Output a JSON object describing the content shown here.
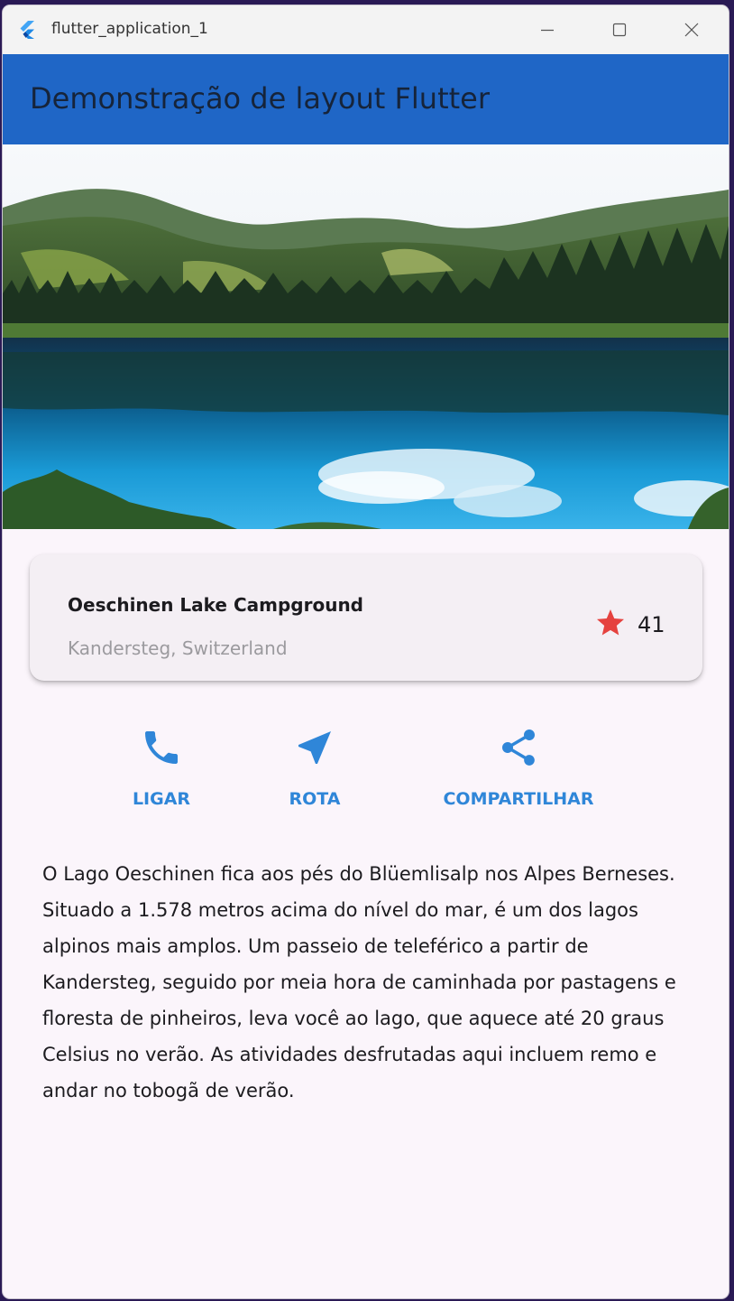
{
  "window": {
    "title": "flutter_application_1"
  },
  "appbar": {
    "title": "Demonstração de layout Flutter",
    "color": "#1f66c6"
  },
  "hero": {
    "alt": "lake-landscape-photo"
  },
  "card": {
    "title": "Oeschinen Lake Campground",
    "subtitle": "Kandersteg, Switzerland",
    "rating": "41",
    "star_color": "#e5423f"
  },
  "actions": [
    {
      "label": "LIGAR",
      "icon": "phone-icon"
    },
    {
      "label": "ROTA",
      "icon": "navigation-arrow-icon"
    },
    {
      "label": "COMPARTILHAR",
      "icon": "share-icon"
    }
  ],
  "accent_color": "#2f86d8",
  "description": "O Lago Oeschinen fica aos pés do Blüemlisalp nos Alpes Berneses. Situado a 1.578 metros acima do nível do mar, é um dos lagos alpinos mais amplos. Um passeio de teleférico a partir de Kandersteg, seguido por meia hora de caminhada por pastagens e floresta de pinheiros, leva você ao lago, que aquece até 20 graus Celsius no verão. As atividades desfrutadas aqui incluem remo e andar no tobogã de verão."
}
